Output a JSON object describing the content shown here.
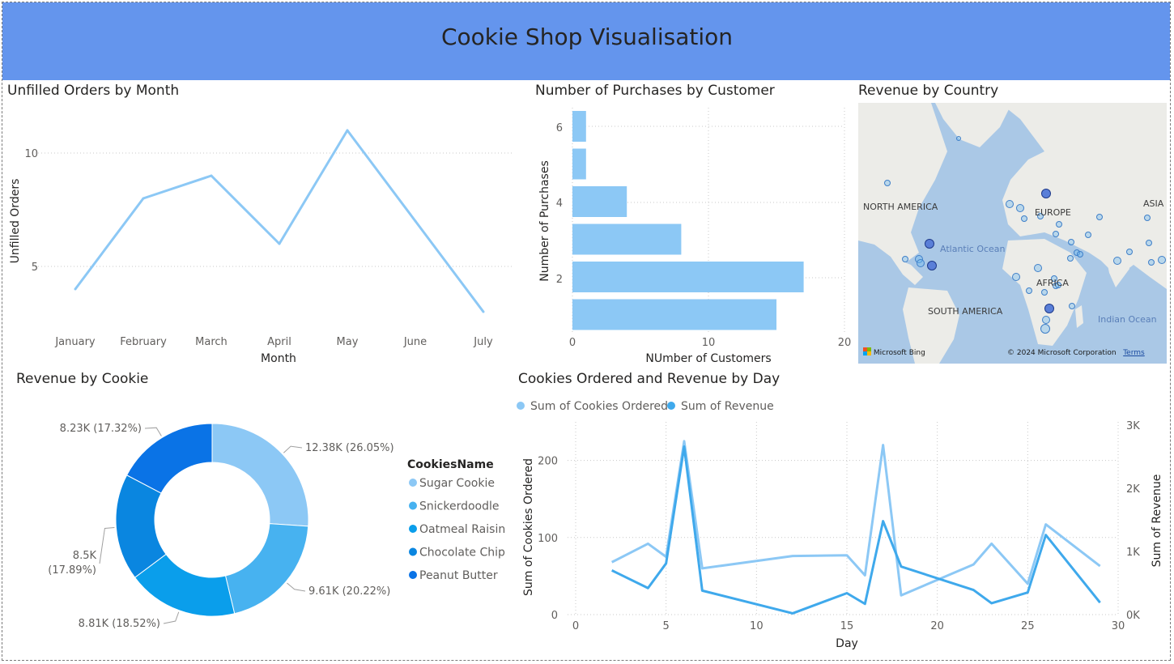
{
  "banner": {
    "title": "Cookie Shop Visualisation",
    "color": "#6495ed"
  },
  "unfilled": {
    "title": "Unfilled Orders by Month",
    "chart_data": {
      "type": "line",
      "categories": [
        "January",
        "February",
        "March",
        "April",
        "May",
        "June",
        "July"
      ],
      "values": [
        4,
        8,
        9,
        6,
        11,
        7,
        3
      ],
      "xlabel": "Month",
      "ylabel": "Unfilled Orders",
      "yticks": [
        5,
        10
      ],
      "ylim": [
        2,
        12
      ],
      "grid": true,
      "color": "#8cc8f5"
    }
  },
  "purchases": {
    "title": "Number of Purchases by Customer",
    "chart_data": {
      "type": "bar",
      "orientation": "horizontal",
      "categories": [
        1,
        2,
        3,
        4,
        5,
        6
      ],
      "values": [
        15,
        17,
        8,
        4,
        1,
        1
      ],
      "ytick_labels": [
        "2",
        "4",
        "6"
      ],
      "xticks": [
        "0",
        "10",
        "20"
      ],
      "xlim": [
        0,
        20
      ],
      "xlabel": "NUmber of Customers",
      "ylabel": "Number of Purchases",
      "color": "#8cc8f5",
      "grid": true
    }
  },
  "map": {
    "title": "Revenue by Country",
    "labels": {
      "north_america": "NORTH AMERICA",
      "europe": "EUROPE",
      "asia": "ASIA",
      "africa": "AFRICA",
      "south_america": "SOUTH AMERICA"
    },
    "seas": {
      "atlantic": "Atlantic Ocean",
      "indian": "Indian Ocean"
    },
    "credit_logo": "Microsoft Bing",
    "copyright": "© 2024 Microsoft Corporation",
    "terms": "Terms",
    "bubble_color": "#6fb8f0"
  },
  "donut": {
    "title": "Revenue by Cookie",
    "legend_title": "CookiesName",
    "chart_data": {
      "type": "pie",
      "donut": true,
      "categories": [
        "Sugar Cookie",
        "Snickerdoodle",
        "Oatmeal Raisin",
        "Chocolate Chip",
        "Peanut Butter"
      ],
      "values": [
        12380,
        9610,
        8810,
        8500,
        8230
      ],
      "percents": [
        26.05,
        20.22,
        18.52,
        17.89,
        17.32
      ],
      "data_labels": [
        "12.38K (26.05%)",
        "9.61K (20.22%)",
        "8.81K (18.52%)",
        "8.5K (17.89%)",
        "8.23K (17.32%)"
      ],
      "colors": [
        "#8cc8f5",
        "#47b2f0",
        "#0a9eeb",
        "#0a86e0",
        "#0a73e6"
      ]
    }
  },
  "combo": {
    "title": "Cookies Ordered and Revenue by Day",
    "chart_data": {
      "type": "line",
      "x": [
        2,
        4,
        5,
        6,
        7,
        12,
        15,
        16,
        17,
        18,
        22,
        23,
        25,
        26,
        29
      ],
      "series": [
        {
          "name": "Sum of Cookies Ordered",
          "axis": "left",
          "color": "#8cc8f5",
          "values": [
            68,
            92,
            75,
            225,
            60,
            76,
            77,
            51,
            220,
            25,
            65,
            92,
            40,
            117,
            63
          ]
        },
        {
          "name": "Sum of Revenue",
          "axis": "right",
          "color": "#3fa9ec",
          "values": [
            700,
            420,
            810,
            2660,
            380,
            20,
            340,
            170,
            1480,
            760,
            390,
            180,
            350,
            1260,
            190
          ]
        }
      ],
      "xlabel": "Day",
      "ylabel_left": "Sum of Cookies Ordered",
      "ylabel_right": "Sum of Revenue",
      "xticks": [
        "0",
        "5",
        "10",
        "15",
        "20",
        "25",
        "30"
      ],
      "xlim": [
        0,
        30
      ],
      "yticks_left": [
        "0",
        "100",
        "200"
      ],
      "ylim_left": [
        0,
        250
      ],
      "yticks_right": [
        "0K",
        "1K",
        "2K",
        "3K"
      ],
      "ylim_right": [
        0,
        3000
      ],
      "grid": true,
      "legend_position": "top-left"
    }
  }
}
